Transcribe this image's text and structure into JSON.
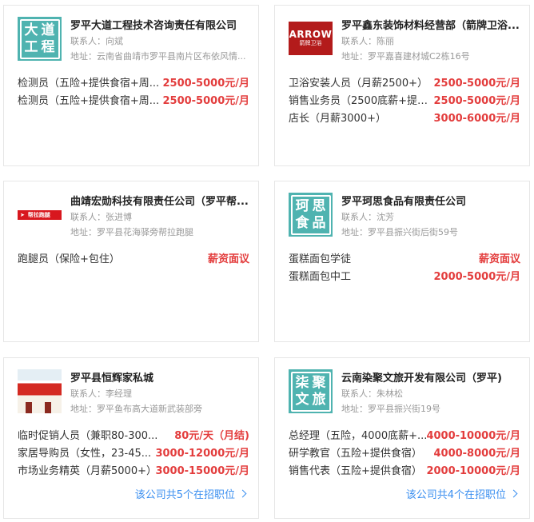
{
  "colors": {
    "salary": "#e33d3d",
    "link": "#3b8ff0",
    "logo_teal": "#4fb3b0",
    "logo_arrow": "#b31b1b"
  },
  "cards": [
    {
      "company": "罗平大道工程技术咨询责任有限公司",
      "contact": "联系人：向斌",
      "address": "地址：云南省曲靖市罗平县南片区布依风情...",
      "logo_chars": [
        "大",
        "道",
        "工",
        "程"
      ],
      "jobs": [
        {
          "name": "检测员（五险+提供食宿+周...",
          "salary": "2500-5000元/月"
        },
        {
          "name": "检测员（五险+提供食宿+周...",
          "salary": "2500-5000元/月"
        }
      ]
    },
    {
      "company": "罗平鑫东装饰材料经营部（箭牌卫浴...",
      "contact": "联系人：陈丽",
      "address": "地址：罗平嘉喜建材城C2栋16号",
      "logo_text": "ARROW",
      "logo_sub": "箭牌卫浴",
      "jobs": [
        {
          "name": "卫浴安装人员（月薪2500+）",
          "salary": "2500-5000元/月"
        },
        {
          "name": "销售业务员（2500底薪+提成...",
          "salary": "2500-5000元/月"
        },
        {
          "name": "店长（月薪3000+）",
          "salary": "3000-6000元/月"
        }
      ]
    },
    {
      "company": "曲靖宏勋科技有限责任公司（罗平帮...",
      "contact": "联系人：张进博",
      "address": "地址：罗平县花海驿旁帮拉跑腿",
      "logo_text": "帮拉跑腿",
      "jobs": [
        {
          "name": "跑腿员（保险+包住）",
          "salary": "薪资面议"
        }
      ]
    },
    {
      "company": "罗平珂思食品有限责任公司",
      "contact": "联系人：沈芳",
      "address": "地址：罗平县振兴街后街59号",
      "logo_chars": [
        "珂",
        "思",
        "食",
        "品"
      ],
      "jobs": [
        {
          "name": "蛋糕面包学徒",
          "salary": "薪资面议"
        },
        {
          "name": "蛋糕面包中工",
          "salary": "2000-5000元/月"
        }
      ]
    },
    {
      "company": "罗平县恒辉家私城",
      "contact": "联系人：李经理",
      "address": "地址：罗平鱼布高大道新武装部旁",
      "jobs": [
        {
          "name": "临时促销人员（兼职80-300...",
          "salary": "80元/天（月结)"
        },
        {
          "name": "家居导购员（女性，23-45...",
          "salary": "3000-12000元/月"
        },
        {
          "name": "市场业务精英（月薪5000+）",
          "salary": "3000-15000元/月"
        }
      ],
      "more": "该公司共5个在招职位"
    },
    {
      "company": "云南染聚文旅开发有限公司（罗平)",
      "contact": "联系人：朱林松",
      "address": "地址：罗平县振兴街19号",
      "logo_chars": [
        "柒",
        "聚",
        "文",
        "旅"
      ],
      "jobs": [
        {
          "name": "总经理（五险，4000底薪+...",
          "salary": "4000-10000元/月"
        },
        {
          "name": "研学教官（五险+提供食宿）",
          "salary": "4000-8000元/月"
        },
        {
          "name": "销售代表（五险+提供食宿）",
          "salary": "2000-10000元/月"
        }
      ],
      "more": "该公司共4个在招职位"
    }
  ]
}
